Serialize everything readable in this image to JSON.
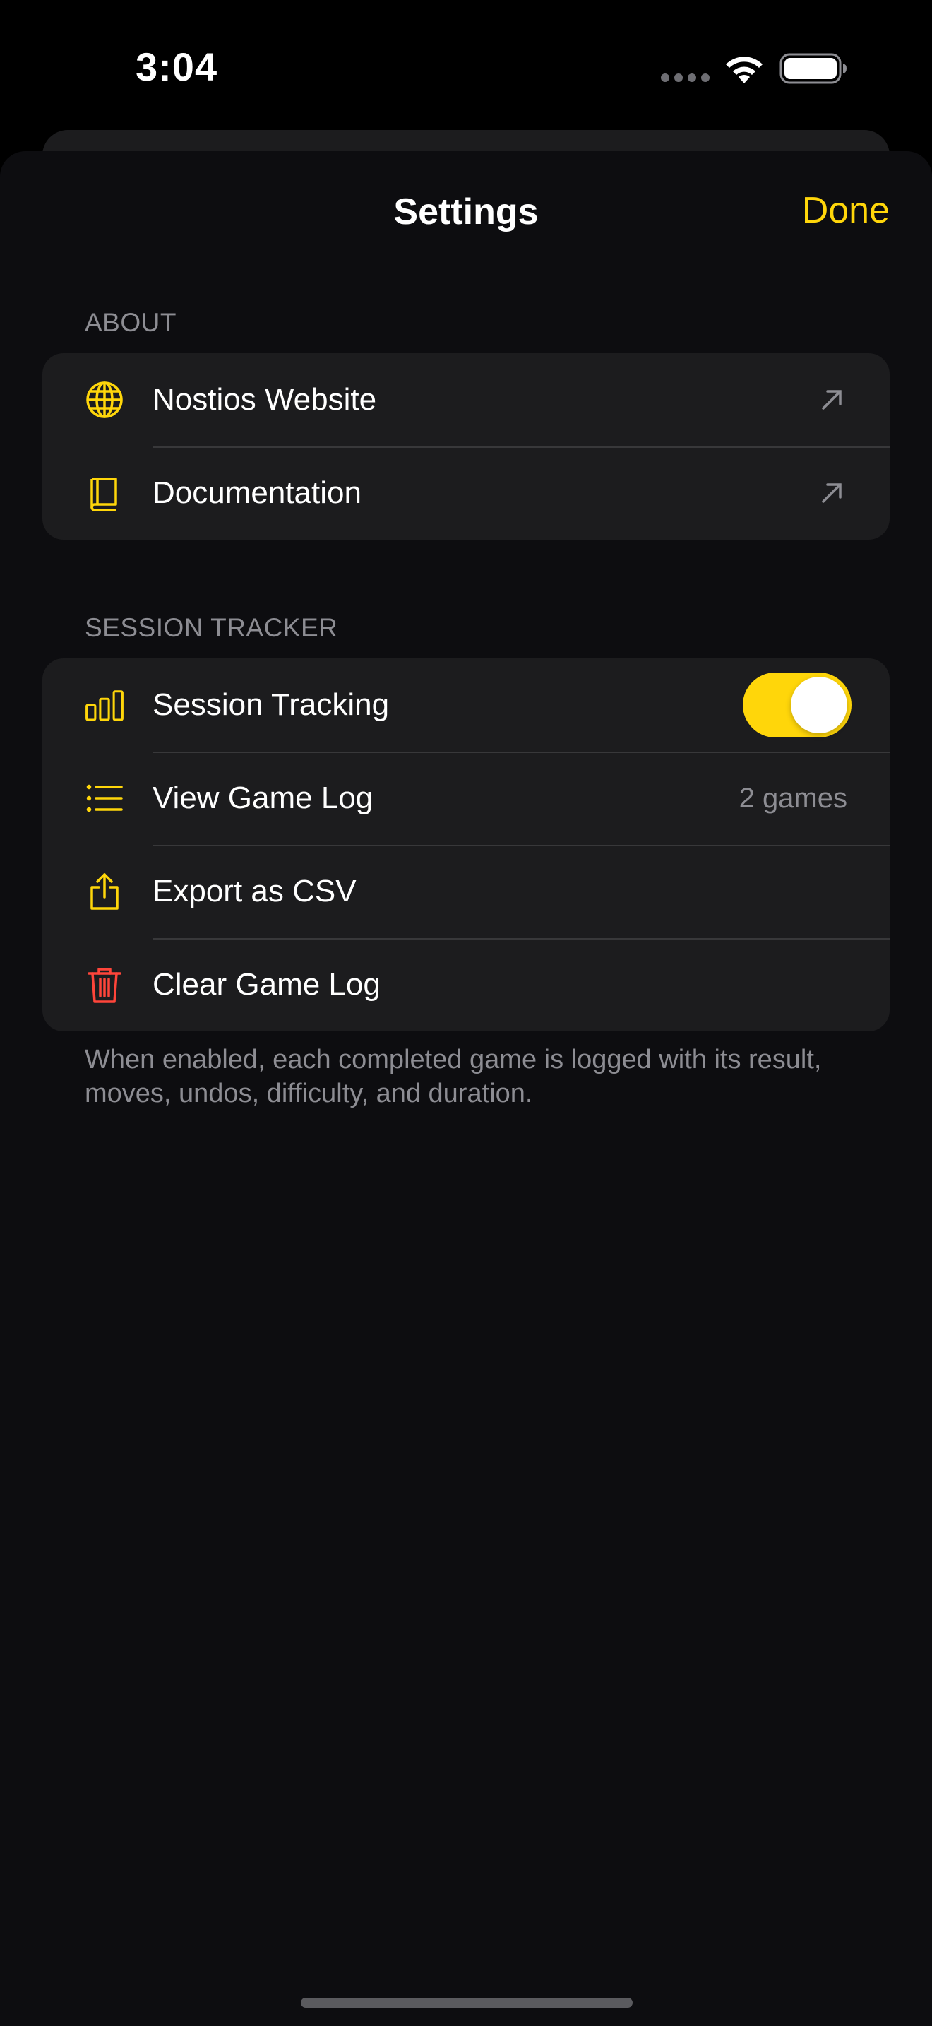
{
  "status_bar": {
    "time": "3:04",
    "icons": [
      "cellular-dots-icon",
      "wifi-icon",
      "battery-icon"
    ]
  },
  "nav": {
    "title": "Settings",
    "done_label": "Done"
  },
  "colors": {
    "accent": "#ffd60a",
    "destructive": "#ff453a",
    "background": "#0d0d10",
    "group_background": "#1c1c1e",
    "secondary_text": "#8d8d93"
  },
  "about": {
    "header": "ABOUT",
    "items": [
      {
        "label": "Nostios Website",
        "icon": "globe-icon",
        "accessory": "external-link-arrow-icon"
      },
      {
        "label": "Documentation",
        "icon": "book-icon",
        "accessory": "external-link-arrow-icon"
      }
    ]
  },
  "session_tracker": {
    "header": "SESSION TRACKER",
    "items": [
      {
        "label": "Session Tracking",
        "icon": "bar-chart-icon",
        "toggle_on": true
      },
      {
        "label": "View Game Log",
        "icon": "list-icon",
        "value": "2 games"
      },
      {
        "label": "Export as CSV",
        "icon": "share-icon"
      },
      {
        "label": "Clear Game Log",
        "icon": "trash-icon",
        "destructive": true
      }
    ],
    "footer": "When enabled, each completed game is logged with its result, moves, undos, difficulty, and duration."
  }
}
